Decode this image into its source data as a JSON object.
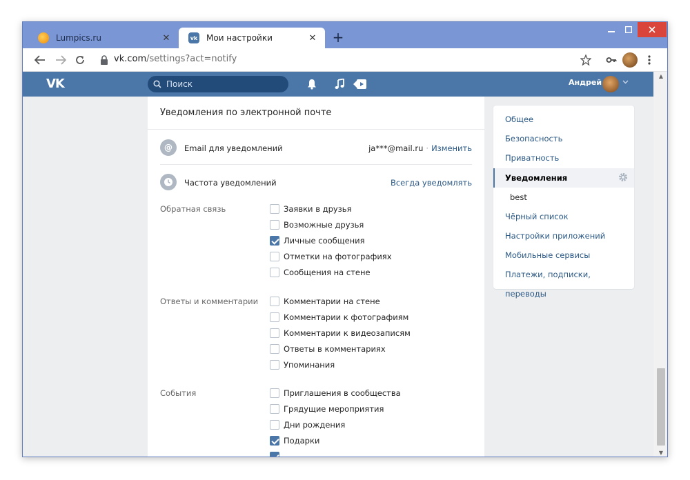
{
  "browser": {
    "tabs": [
      {
        "title": "Lumpics.ru",
        "active": false,
        "favicon": "lumpics-favicon"
      },
      {
        "title": "Мои настройки",
        "active": true,
        "favicon": "vk-favicon"
      }
    ],
    "new_tab_label": "+",
    "url_host": "vk.com",
    "url_path": "/settings?act=notify",
    "close_glyph": "✕"
  },
  "vk": {
    "logo_text": "VK",
    "search_placeholder": "Поиск",
    "user_name": "Андрей",
    "colors": {
      "header": "#4a76a8",
      "link": "#2a5885",
      "checked": "#4a76a8"
    }
  },
  "panel": {
    "title": "Уведомления по электронной почте",
    "email_row": {
      "label": "Email для уведомлений",
      "value": "ja***@mail.ru",
      "separator": "·",
      "action": "Изменить"
    },
    "frequency_row": {
      "label": "Частота уведомлений",
      "value": "Всегда уведомлять"
    },
    "groups": [
      {
        "label": "Обратная связь",
        "items": [
          {
            "label": "Заявки в друзья",
            "checked": false
          },
          {
            "label": "Возможные друзья",
            "checked": false
          },
          {
            "label": "Личные сообщения",
            "checked": true
          },
          {
            "label": "Отметки на фотографиях",
            "checked": false
          },
          {
            "label": "Сообщения на стене",
            "checked": false
          }
        ]
      },
      {
        "label": "Ответы и комментарии",
        "items": [
          {
            "label": "Комментарии на стене",
            "checked": false
          },
          {
            "label": "Комментарии к фотографиям",
            "checked": false
          },
          {
            "label": "Комментарии к видеозаписям",
            "checked": false
          },
          {
            "label": "Ответы в комментариях",
            "checked": false
          },
          {
            "label": "Упоминания",
            "checked": false
          }
        ]
      },
      {
        "label": "События",
        "items": [
          {
            "label": "Приглашения в сообщества",
            "checked": false
          },
          {
            "label": "Грядущие мероприятия",
            "checked": false
          },
          {
            "label": "Дни рождения",
            "checked": false
          },
          {
            "label": "Подарки",
            "checked": true
          },
          {
            "label": "",
            "checked": true
          }
        ]
      }
    ]
  },
  "sidebar": {
    "items": [
      {
        "label": "Общее"
      },
      {
        "label": "Безопасность"
      },
      {
        "label": "Приватность"
      },
      {
        "label": "Уведомления",
        "active": true
      },
      {
        "label": "best",
        "sub": true
      },
      {
        "label": "Чёрный список"
      },
      {
        "label": "Настройки приложений"
      },
      {
        "label": "Мобильные сервисы"
      },
      {
        "label": "Платежи, подписки, переводы"
      }
    ]
  }
}
